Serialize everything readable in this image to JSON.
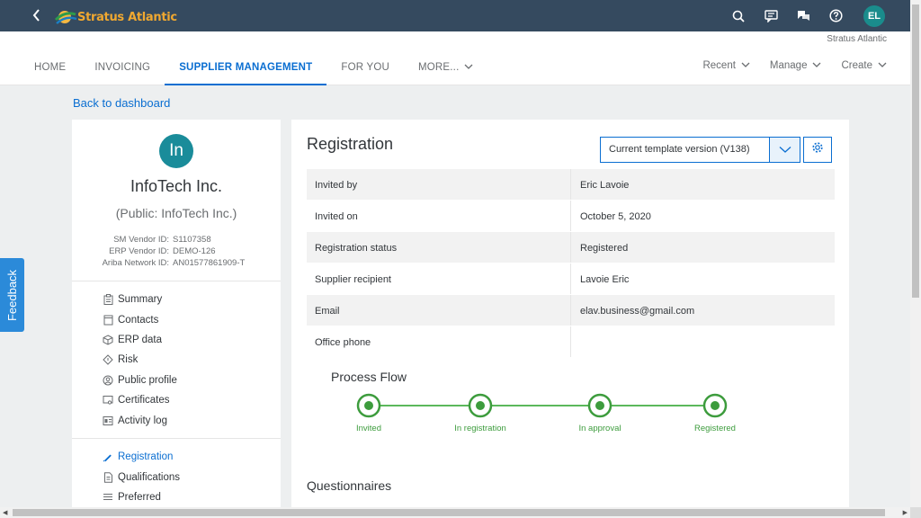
{
  "shell": {
    "brand": "Stratus Atlantic",
    "avatar_initials": "EL",
    "icons": [
      "back-icon",
      "search-icon",
      "feedback-icon",
      "chat-icon",
      "help-icon"
    ]
  },
  "subheader": {
    "company": "Stratus Atlantic",
    "tabs": [
      {
        "label": "HOME"
      },
      {
        "label": "INVOICING"
      },
      {
        "label": "SUPPLIER MANAGEMENT",
        "active": true
      },
      {
        "label": "FOR YOU"
      },
      {
        "label": "MORE..."
      }
    ],
    "right_menus": [
      {
        "label": "Recent"
      },
      {
        "label": "Manage"
      },
      {
        "label": "Create"
      }
    ]
  },
  "back_link": "Back to dashboard",
  "supplier": {
    "avatar": "In",
    "name": "InfoTech Inc.",
    "public_name": "(Public: InfoTech Inc.)",
    "ids": [
      {
        "label": "SM Vendor ID:",
        "value": "S1107358"
      },
      {
        "label": "ERP Vendor ID:",
        "value": "DEMO-126"
      },
      {
        "label": "Ariba Network ID:",
        "value": "AN01577861909-T"
      }
    ]
  },
  "nav": {
    "group1": [
      {
        "label": "Summary",
        "icon": "clipboard-icon"
      },
      {
        "label": "Contacts",
        "icon": "contacts-icon"
      },
      {
        "label": "ERP data",
        "icon": "cube-icon"
      },
      {
        "label": "Risk",
        "icon": "diamond-icon"
      },
      {
        "label": "Public profile",
        "icon": "person-icon"
      },
      {
        "label": "Certificates",
        "icon": "certificate-icon"
      },
      {
        "label": "Activity log",
        "icon": "log-icon"
      }
    ],
    "group2": [
      {
        "label": "Registration",
        "icon": "pen-icon",
        "active": true
      },
      {
        "label": "Qualifications",
        "icon": "document-icon"
      },
      {
        "label": "Preferred",
        "icon": "list-icon"
      }
    ]
  },
  "registration": {
    "title": "Registration",
    "template_select": "Current template version (V138)",
    "rows": [
      {
        "label": "Invited by",
        "value": "Eric Lavoie"
      },
      {
        "label": "Invited on",
        "value": "October 5, 2020"
      },
      {
        "label": "Registration status",
        "value": "Registered"
      },
      {
        "label": "Supplier recipient",
        "value": "Lavoie Eric"
      },
      {
        "label": "Email",
        "value": "elav.business@gmail.com"
      },
      {
        "label": "Office phone",
        "value": ""
      }
    ]
  },
  "process_flow": {
    "title": "Process Flow",
    "steps": [
      {
        "label": "Invited"
      },
      {
        "label": "In registration"
      },
      {
        "label": "In approval"
      },
      {
        "label": "Registered"
      }
    ],
    "color": "#3d9c3d"
  },
  "questionnaires_title": "Questionnaires",
  "feedback_label": "Feedback"
}
